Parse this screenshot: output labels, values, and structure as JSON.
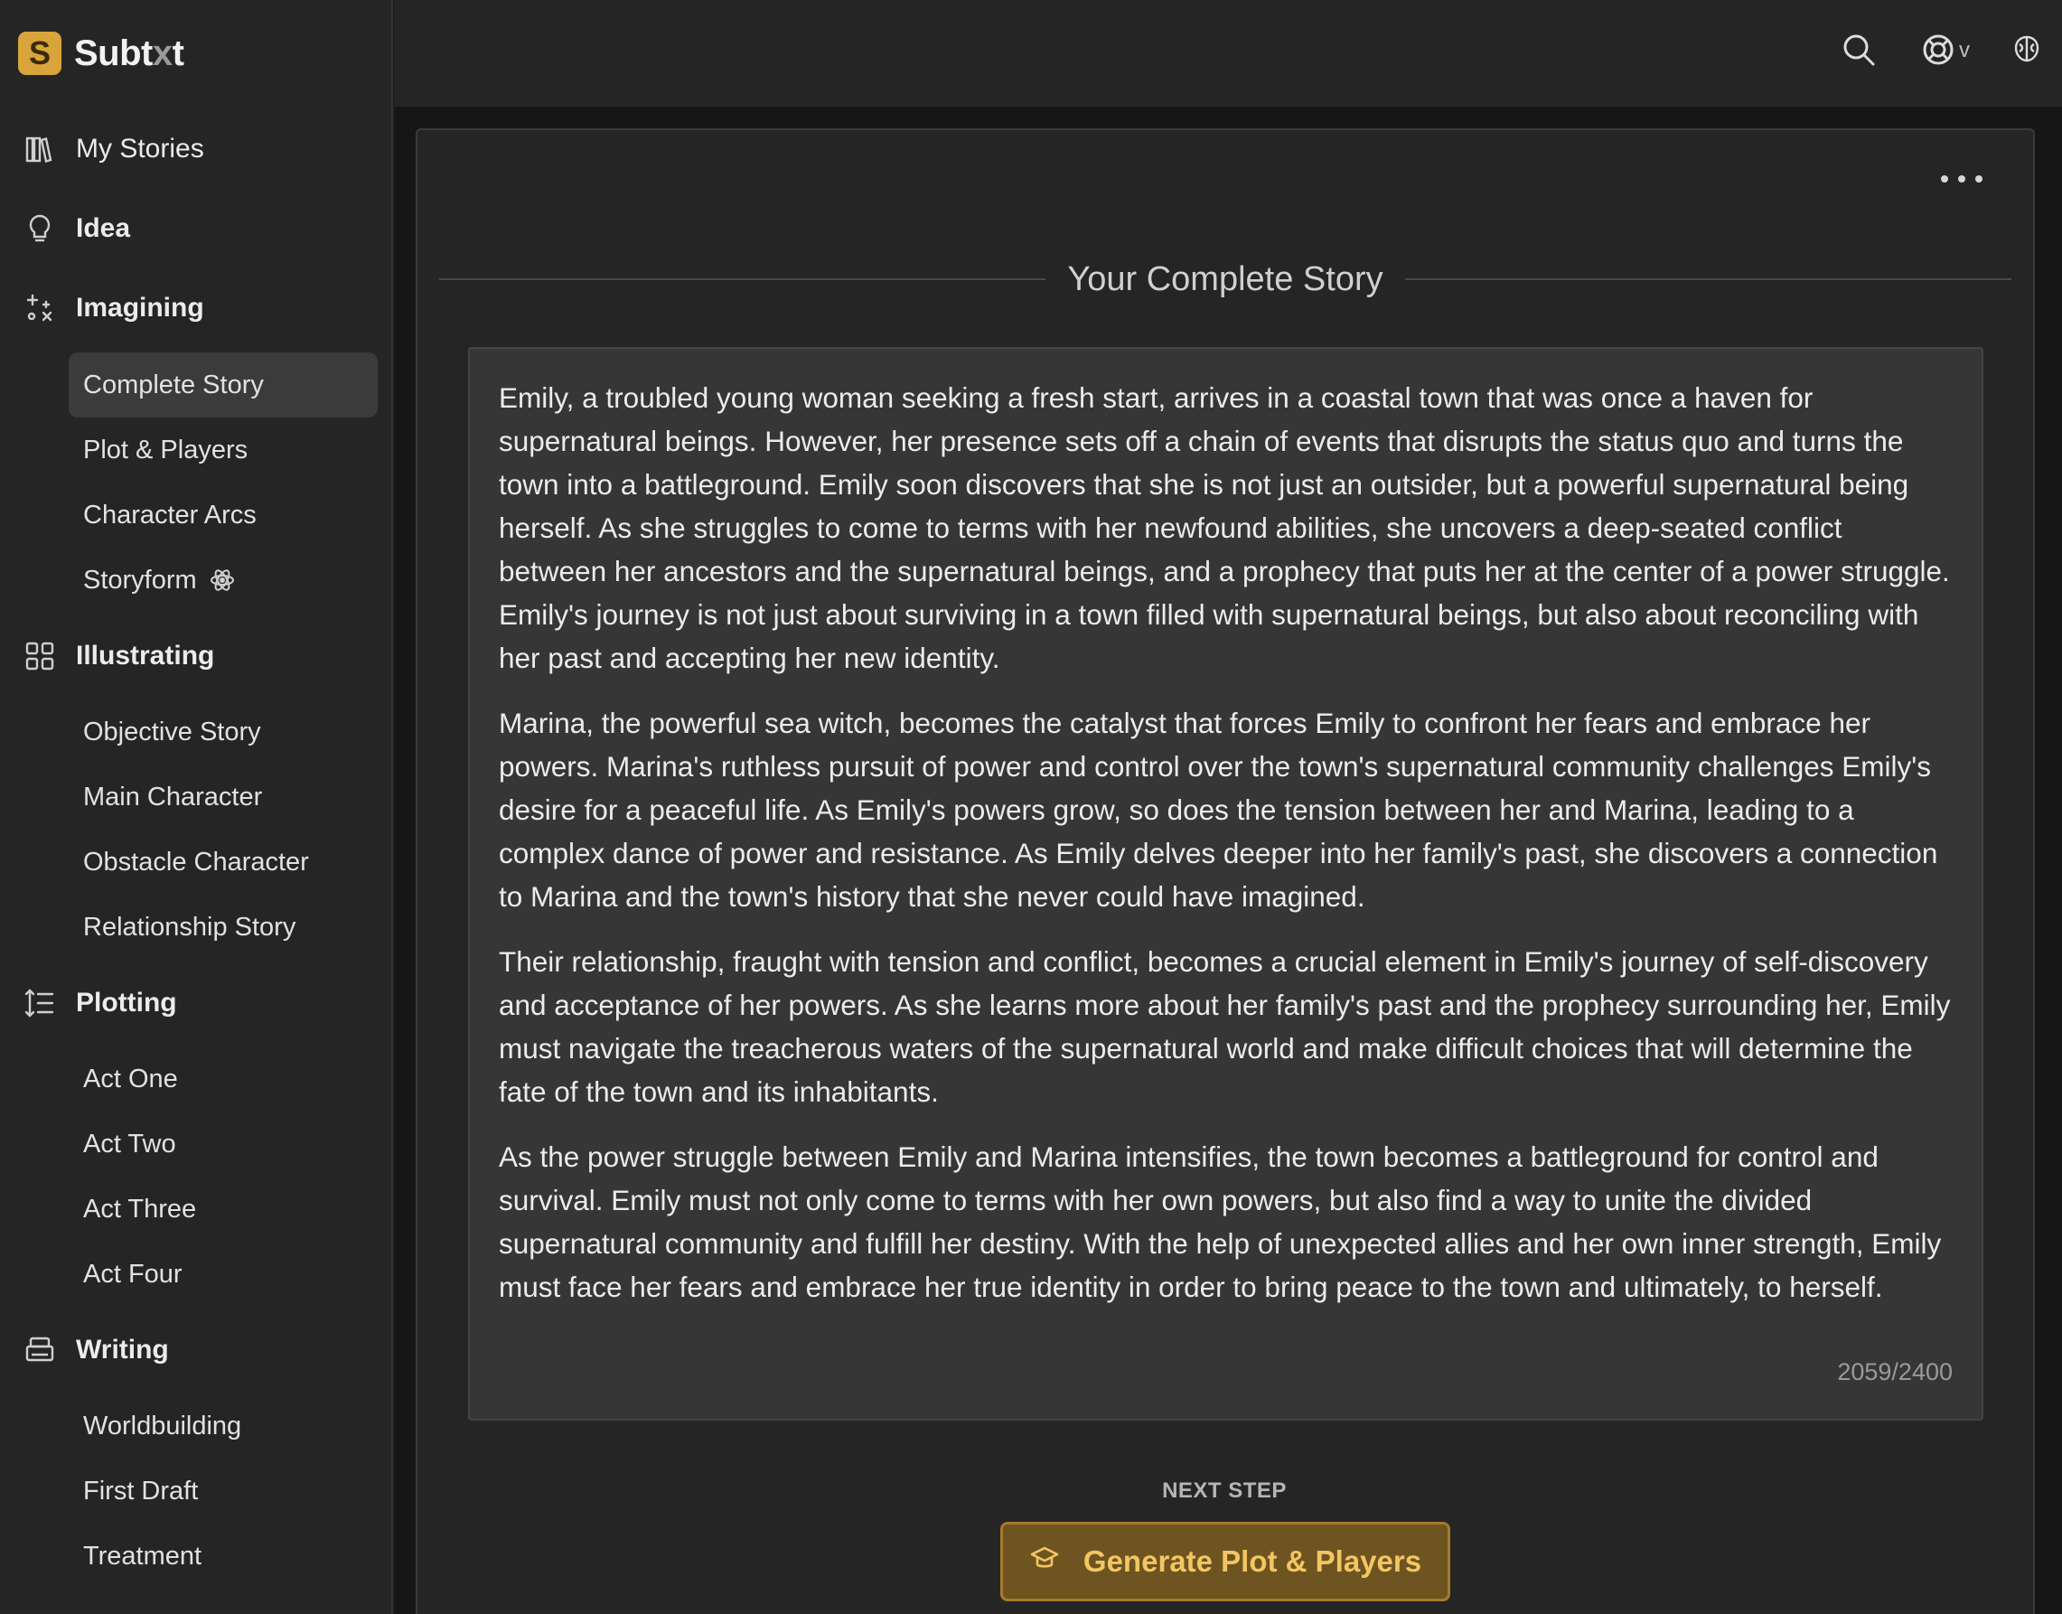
{
  "brand": {
    "name_main": "Subt",
    "name_x": "x",
    "name_end": "t",
    "logo_letter": "S",
    "logo_color": "#d9a43a"
  },
  "sidebar": {
    "sections": [
      {
        "label": "My Stories",
        "icon": "library-icon"
      },
      {
        "label": "Idea",
        "icon": "lightbulb-icon"
      },
      {
        "label": "Imagining",
        "icon": "sparkles-icon",
        "items": [
          "Complete Story",
          "Plot & Players",
          "Character Arcs",
          "Storyform"
        ]
      },
      {
        "label": "Illustrating",
        "icon": "grid-icon",
        "items": [
          "Objective Story",
          "Main Character",
          "Obstacle Character",
          "Relationship Story"
        ]
      },
      {
        "label": "Plotting",
        "icon": "list-ordered-icon",
        "items": [
          "Act One",
          "Act Two",
          "Act Three",
          "Act Four"
        ]
      },
      {
        "label": "Writing",
        "icon": "printer-icon",
        "items": [
          "Worldbuilding",
          "First Draft",
          "Treatment"
        ]
      }
    ],
    "active_item": "Complete Story"
  },
  "topbar": {
    "icons": [
      "search-icon",
      "help-icon",
      "brain-icon"
    ],
    "help_chevron": "v"
  },
  "main": {
    "title": "Your Complete Story",
    "paragraphs": [
      "Emily, a troubled young woman seeking a fresh start, arrives in a coastal town that was once a haven for supernatural beings. However, her presence sets off a chain of events that disrupts the status quo and turns the town into a battleground. Emily soon discovers that she is not just an outsider, but a powerful supernatural being herself. As she struggles to come to terms with her newfound abilities, she uncovers a deep-seated conflict between her ancestors and the supernatural beings, and a prophecy that puts her at the center of a power struggle. Emily's journey is not just about surviving in a town filled with supernatural beings, but also about reconciling with her past and accepting her new identity.",
      "Marina, the powerful sea witch, becomes the catalyst that forces Emily to confront her fears and embrace her powers. Marina's ruthless pursuit of power and control over the town's supernatural community challenges Emily's desire for a peaceful life. As Emily's powers grow, so does the tension between her and Marina, leading to a complex dance of power and resistance. As Emily delves deeper into her family's past, she discovers a connection to Marina and the town's history that she never could have imagined.",
      "Their relationship, fraught with tension and conflict, becomes a crucial element in Emily's journey of self-discovery and acceptance of her powers. As she learns more about her family's past and the prophecy surrounding her, Emily must navigate the treacherous waters of the supernatural world and make difficult choices that will determine the fate of the town and its inhabitants.",
      "As the power struggle between Emily and Marina intensifies, the town becomes a battleground for control and survival. Emily must not only come to terms with her own powers, but also find a way to unite the divided supernatural community and fulfill her destiny. With the help of unexpected allies and her own inner strength, Emily must face her fears and embrace her true identity in order to bring peace to the town and ultimately, to herself."
    ],
    "char_count": "2059/2400",
    "next_step_label": "NEXT STEP",
    "next_button_label": "Generate Plot & Players",
    "accent_color": "#f2c662"
  }
}
